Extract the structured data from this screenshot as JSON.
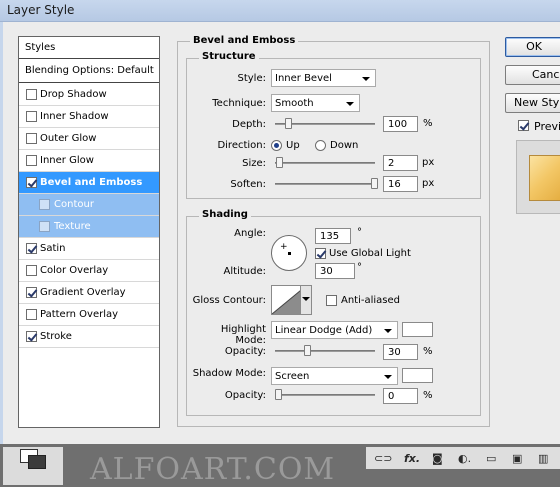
{
  "window": {
    "title": "Layer Style"
  },
  "styles_list": {
    "header": "Styles",
    "blending": "Blending Options: Default",
    "items": [
      {
        "label": "Drop Shadow",
        "checked": false,
        "state": "normal"
      },
      {
        "label": "Inner Shadow",
        "checked": false,
        "state": "normal"
      },
      {
        "label": "Outer Glow",
        "checked": false,
        "state": "normal"
      },
      {
        "label": "Inner Glow",
        "checked": false,
        "state": "normal"
      },
      {
        "label": "Bevel and Emboss",
        "checked": true,
        "state": "selected"
      },
      {
        "label": "Contour",
        "checked": false,
        "state": "sub"
      },
      {
        "label": "Texture",
        "checked": false,
        "state": "sub"
      },
      {
        "label": "Satin",
        "checked": true,
        "state": "normal"
      },
      {
        "label": "Color Overlay",
        "checked": false,
        "state": "normal"
      },
      {
        "label": "Gradient Overlay",
        "checked": true,
        "state": "normal"
      },
      {
        "label": "Pattern Overlay",
        "checked": false,
        "state": "normal"
      },
      {
        "label": "Stroke",
        "checked": true,
        "state": "normal"
      }
    ]
  },
  "bevel": {
    "section_title": "Bevel and Emboss",
    "structure": {
      "legend": "Structure",
      "style_label": "Style:",
      "style_value": "Inner Bevel",
      "technique_label": "Technique:",
      "technique_value": "Smooth",
      "depth_label": "Depth:",
      "depth_value": "100",
      "depth_unit": "%",
      "depth_level": 0.1,
      "direction_label": "Direction:",
      "dir_up": "Up",
      "dir_down": "Down",
      "dir_selected": "Up",
      "size_label": "Size:",
      "size_value": "2",
      "size_unit": "px",
      "size_level": 0.01,
      "soften_label": "Soften:",
      "soften_value": "16",
      "soften_unit": "px",
      "soften_level": 1.0
    },
    "shading": {
      "legend": "Shading",
      "angle_label": "Angle:",
      "angle_value": "135",
      "angle_unit": "°",
      "use_global_light": "Use Global Light",
      "use_global_light_checked": true,
      "altitude_label": "Altitude:",
      "altitude_value": "30",
      "altitude_unit": "°",
      "gloss_label": "Gloss Contour:",
      "anti_aliased": "Anti-aliased",
      "anti_aliased_checked": false,
      "highlight_label": "Highlight Mode:",
      "highlight_value": "Linear Dodge (Add)",
      "highlight_color": "#ffffff",
      "hl_opacity_label": "Opacity:",
      "hl_opacity_value": "30",
      "hl_opacity_unit": "%",
      "hl_opacity_level": 0.3,
      "shadow_label": "Shadow Mode:",
      "shadow_value": "Screen",
      "shadow_color": "#ffffff",
      "sh_opacity_label": "Opacity:",
      "sh_opacity_value": "0",
      "sh_opacity_unit": "%",
      "sh_opacity_level": 0.0
    }
  },
  "buttons": {
    "ok": "OK",
    "cancel": "Cancel",
    "new_style": "New Style...",
    "preview": "Preview",
    "preview_checked": true
  },
  "bottom": {
    "watermark": "ALFOART.COM",
    "icons": [
      "link-icon",
      "fx-icon",
      "mask-icon",
      "adjustment-icon",
      "folder-icon",
      "new-layer-icon",
      "trash-icon"
    ]
  }
}
